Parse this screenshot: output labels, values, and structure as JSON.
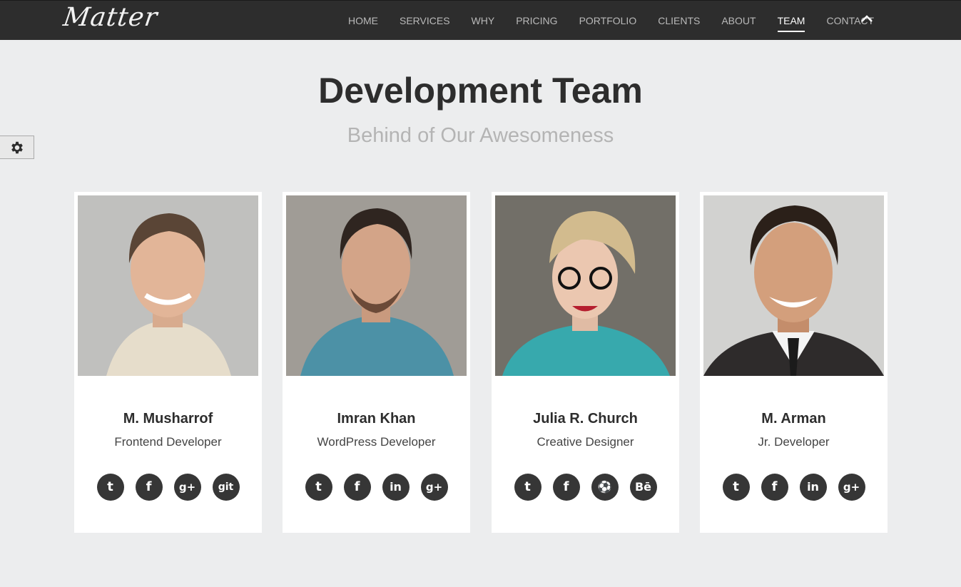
{
  "header": {
    "logo": "Matter",
    "nav": [
      "HOME",
      "SERVICES",
      "WHY",
      "PRICING",
      "PORTFOLIO",
      "CLIENTS",
      "ABOUT",
      "TEAM",
      "CONTACT"
    ],
    "active": "TEAM"
  },
  "section": {
    "title": "Development Team",
    "subtitle": "Behind of Our Awesomeness"
  },
  "team": [
    {
      "name": "M. Musharrof",
      "role": "Frontend Developer",
      "socials": [
        {
          "icon": "twitter-icon",
          "glyph": "t"
        },
        {
          "icon": "facebook-icon",
          "glyph": "f"
        },
        {
          "icon": "google-plus-icon",
          "glyph": "g+"
        },
        {
          "icon": "github-icon",
          "glyph": "git"
        }
      ]
    },
    {
      "name": "Imran Khan",
      "role": "WordPress Developer",
      "socials": [
        {
          "icon": "twitter-icon",
          "glyph": "t"
        },
        {
          "icon": "facebook-icon",
          "glyph": "f"
        },
        {
          "icon": "linkedin-icon",
          "glyph": "in"
        },
        {
          "icon": "google-plus-icon",
          "glyph": "g+"
        }
      ]
    },
    {
      "name": "Julia R. Church",
      "role": "Creative Designer",
      "socials": [
        {
          "icon": "twitter-icon",
          "glyph": "t"
        },
        {
          "icon": "facebook-icon",
          "glyph": "f"
        },
        {
          "icon": "dribbble-icon",
          "glyph": "⚽"
        },
        {
          "icon": "behance-icon",
          "glyph": "Bē"
        }
      ]
    },
    {
      "name": "M. Arman",
      "role": "Jr. Developer",
      "socials": [
        {
          "icon": "twitter-icon",
          "glyph": "t"
        },
        {
          "icon": "facebook-icon",
          "glyph": "f"
        },
        {
          "icon": "linkedin-icon",
          "glyph": "in"
        },
        {
          "icon": "google-plus-icon",
          "glyph": "g+"
        }
      ]
    }
  ],
  "colors": {
    "nav_bg": "#2d2d2d",
    "page_bg": "#ecedee",
    "social_bg": "#363636"
  }
}
